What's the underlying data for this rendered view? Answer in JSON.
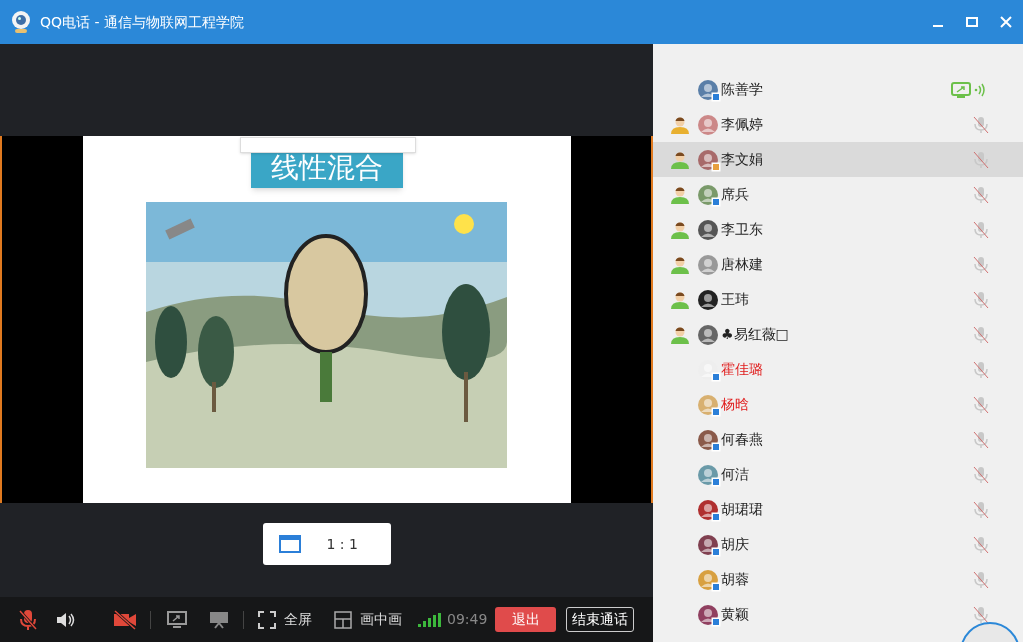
{
  "window": {
    "title": "QQ电话 - 通信与物联网工程学院"
  },
  "slide": {
    "title": "线性混合"
  },
  "view_mode": {
    "label": "1 : 1"
  },
  "toolbar": {
    "mic_muted": true,
    "camera_off": true,
    "fullscreen": "全屏",
    "pip": "画中画",
    "time": "09:49",
    "leave": "退出",
    "end_call": "结束通话"
  },
  "participants": [
    {
      "name": "陈善学",
      "red": false,
      "selected": false,
      "badge": {
        "color": "#2b7fd8"
      },
      "sharing": true,
      "muted": false
    },
    {
      "name": "李佩婷",
      "red": false,
      "selected": false,
      "role": {
        "color": "#e8b030"
      },
      "sharing": false,
      "muted": true
    },
    {
      "name": "李文娟",
      "red": false,
      "selected": true,
      "role": {
        "color": "#6cc04a"
      },
      "badge": {
        "color": "#e8a040"
      },
      "sharing": false,
      "muted": true
    },
    {
      "name": "席兵",
      "red": false,
      "selected": false,
      "role": {
        "color": "#6cc04a"
      },
      "badge": {
        "color": "#2b7fd8"
      },
      "sharing": false,
      "muted": true
    },
    {
      "name": "李卫东",
      "red": false,
      "selected": false,
      "role": {
        "color": "#6cc04a"
      },
      "sharing": false,
      "muted": true
    },
    {
      "name": "唐林建",
      "red": false,
      "selected": false,
      "role": {
        "color": "#6cc04a"
      },
      "sharing": false,
      "muted": true
    },
    {
      "name": "王玮",
      "red": false,
      "selected": false,
      "role": {
        "color": "#6cc04a"
      },
      "sharing": false,
      "muted": true
    },
    {
      "name": "♣易红薇□",
      "red": false,
      "selected": false,
      "role": {
        "color": "#6cc04a"
      },
      "sharing": false,
      "muted": true
    },
    {
      "name": "霍佳璐",
      "red": true,
      "selected": false,
      "badge": {
        "color": "#2b7fd8"
      },
      "sharing": false,
      "muted": true
    },
    {
      "name": "杨晗",
      "red": true,
      "selected": false,
      "badge": {
        "color": "#2b7fd8"
      },
      "sharing": false,
      "muted": true
    },
    {
      "name": "何春燕",
      "red": false,
      "selected": false,
      "badge": {
        "color": "#2b7fd8"
      },
      "sharing": false,
      "muted": true
    },
    {
      "name": "何洁",
      "red": false,
      "selected": false,
      "badge": {
        "color": "#2b7fd8"
      },
      "sharing": false,
      "muted": true
    },
    {
      "name": "胡珺珺",
      "red": false,
      "selected": false,
      "badge": {
        "color": "#2b7fd8"
      },
      "sharing": false,
      "muted": true
    },
    {
      "name": "胡庆",
      "red": false,
      "selected": false,
      "badge": {
        "color": "#2b7fd8"
      },
      "sharing": false,
      "muted": true
    },
    {
      "name": "胡蓉",
      "red": false,
      "selected": false,
      "badge": {
        "color": "#2b7fd8"
      },
      "sharing": false,
      "muted": true
    },
    {
      "name": "黄颖",
      "red": false,
      "selected": false,
      "badge": {
        "color": "#2b7fd8"
      },
      "sharing": false,
      "muted": true
    }
  ]
}
